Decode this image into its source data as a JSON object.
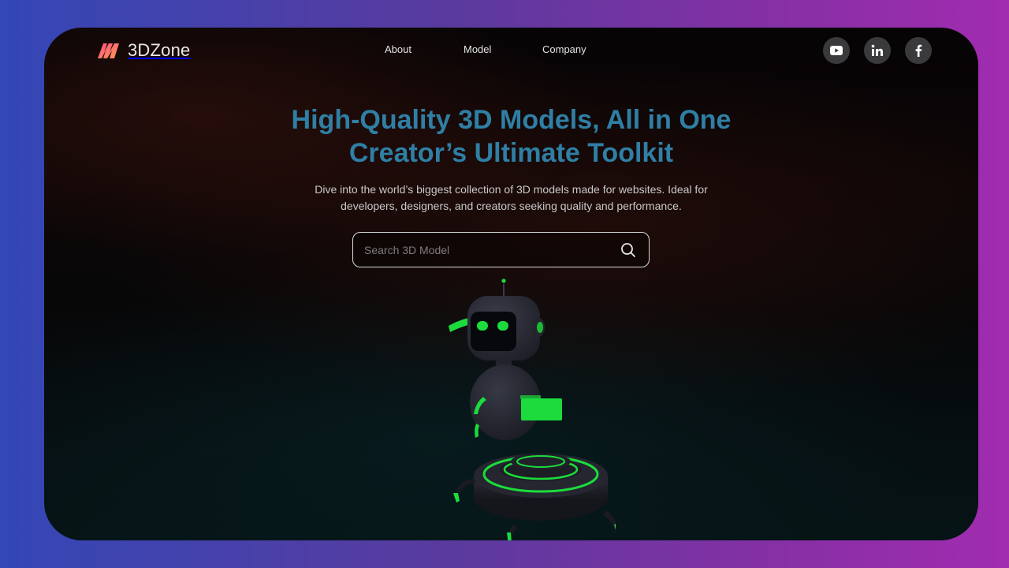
{
  "brand": {
    "name": "3DZone"
  },
  "nav": {
    "items": [
      {
        "label": "About"
      },
      {
        "label": "Model"
      },
      {
        "label": "Company"
      }
    ]
  },
  "socials": [
    {
      "icon": "youtube-icon"
    },
    {
      "icon": "linkedin-icon"
    },
    {
      "icon": "facebook-icon"
    }
  ],
  "hero": {
    "title_line1": "High-Quality 3D Models, All in One",
    "title_line2": "Creator’s Ultimate Toolkit",
    "subtitle_line1": "Dive into the world’s biggest collection of 3D models made for websites. Ideal for",
    "subtitle_line2": "developers, designers, and creators seeking quality and performance."
  },
  "search": {
    "placeholder": "Search 3D Model",
    "value": ""
  },
  "colors": {
    "title": "#2f7fa5",
    "logo_gradient_start": "#ff5b7a",
    "logo_gradient_end": "#ff9a5a",
    "robot_glow": "#1bdc3c"
  }
}
